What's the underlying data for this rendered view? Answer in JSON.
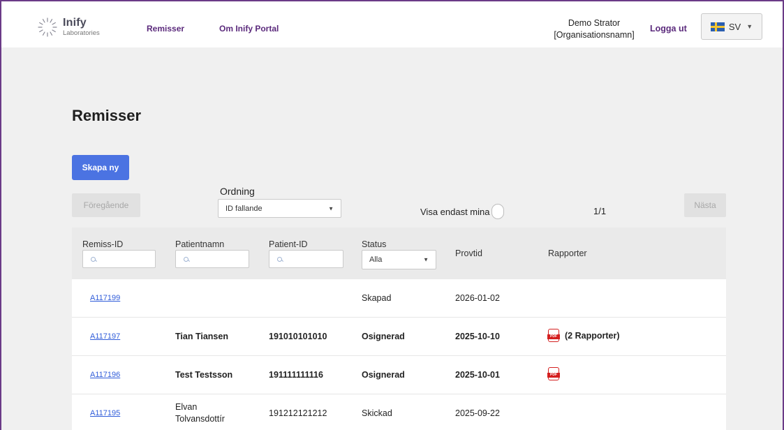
{
  "header": {
    "logo_name": "Inify",
    "logo_sub": "Laboratories",
    "nav": [
      "Remisser",
      "Om Inify Portal"
    ],
    "user_name": "Demo Strator",
    "org_name": "[Organisationsnamn]",
    "logout_label": "Logga ut",
    "language": "SV",
    "language_flag": "sweden-flag-icon"
  },
  "page": {
    "title": "Remisser",
    "create_button": "Skapa ny",
    "prev_button": "Föregående",
    "next_button": "Nästa",
    "order_label": "Ordning",
    "order_value": "ID fallande",
    "only_mine_label": "Visa endast mina",
    "page_count": "1/1"
  },
  "colors": {
    "accent": "#5b2a7c",
    "primary_button": "#4b73e2",
    "link": "#2f5cd9",
    "pdf_red": "#d41f1f"
  },
  "table": {
    "columns": {
      "remiss_id": "Remiss-ID",
      "patient_name": "Patientnamn",
      "patient_id": "Patient-ID",
      "status": "Status",
      "sample_time": "Provtid",
      "reports": "Rapporter"
    },
    "status_filter": "Alla",
    "rows": [
      {
        "remiss_id": "A117199",
        "patient_name": "",
        "patient_id": "",
        "status": "Skapad",
        "sample_time": "2026-01-02",
        "reports": "",
        "bold": false,
        "pdf": false
      },
      {
        "remiss_id": "A117197",
        "patient_name": "Tian Tiansen",
        "patient_id": "191010101010",
        "status": "Osignerad",
        "sample_time": "2025-10-10",
        "reports": "(2 Rapporter)",
        "bold": true,
        "pdf": true
      },
      {
        "remiss_id": "A117196",
        "patient_name": "Test Testsson",
        "patient_id": "191111111116",
        "status": "Osignerad",
        "sample_time": "2025-10-01",
        "reports": "",
        "bold": true,
        "pdf": true
      },
      {
        "remiss_id": "A117195",
        "patient_name_line1": "Elvan",
        "patient_name_line2": "Tolvansdottír",
        "patient_id": "191212121212",
        "status": "Skickad",
        "sample_time": "2025-09-22",
        "reports": "",
        "bold": false,
        "pdf": false
      }
    ]
  }
}
